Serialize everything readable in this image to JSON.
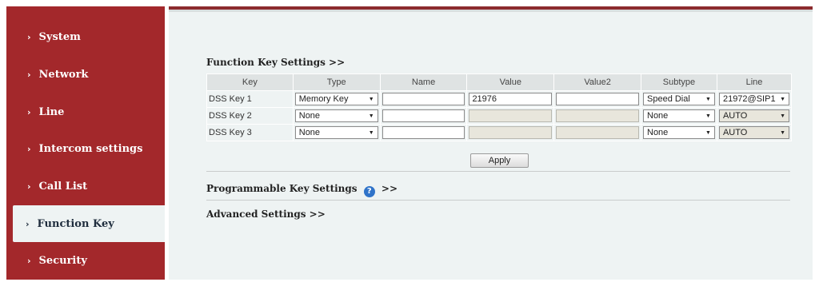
{
  "sidebar": {
    "items": [
      {
        "label": "System",
        "active": false
      },
      {
        "label": "Network",
        "active": false
      },
      {
        "label": "Line",
        "active": false
      },
      {
        "label": "Intercom settings",
        "active": false
      },
      {
        "label": "Call List",
        "active": false
      },
      {
        "label": "Function Key",
        "active": true
      },
      {
        "label": "Security",
        "active": false
      }
    ]
  },
  "colors": {
    "sidebar_bg": "#a3282b",
    "content_bg": "#eef3f3",
    "accent_bar": "#8c2b2e",
    "help_icon": "#2f73c9"
  },
  "function_keys": {
    "title": "Function Key Settings >>",
    "columns": [
      "Key",
      "Type",
      "Name",
      "Value",
      "Value2",
      "Subtype",
      "Line"
    ],
    "rows": [
      {
        "key": "DSS Key 1",
        "type": "Memory Key",
        "name": "",
        "value": "21976",
        "value2": "",
        "subtype": "Speed Dial",
        "line": "21972@SIP1"
      },
      {
        "key": "DSS Key 2",
        "type": "None",
        "name": "",
        "value": "",
        "value2": "",
        "subtype": "None",
        "line": "AUTO"
      },
      {
        "key": "DSS Key 3",
        "type": "None",
        "name": "",
        "value": "",
        "value2": "",
        "subtype": "None",
        "line": "AUTO"
      }
    ],
    "apply_label": "Apply"
  },
  "programmable": {
    "title": "Programmable Key Settings",
    "suffix": ">>",
    "icon": "help-icon"
  },
  "advanced": {
    "title": "Advanced Settings >>"
  }
}
